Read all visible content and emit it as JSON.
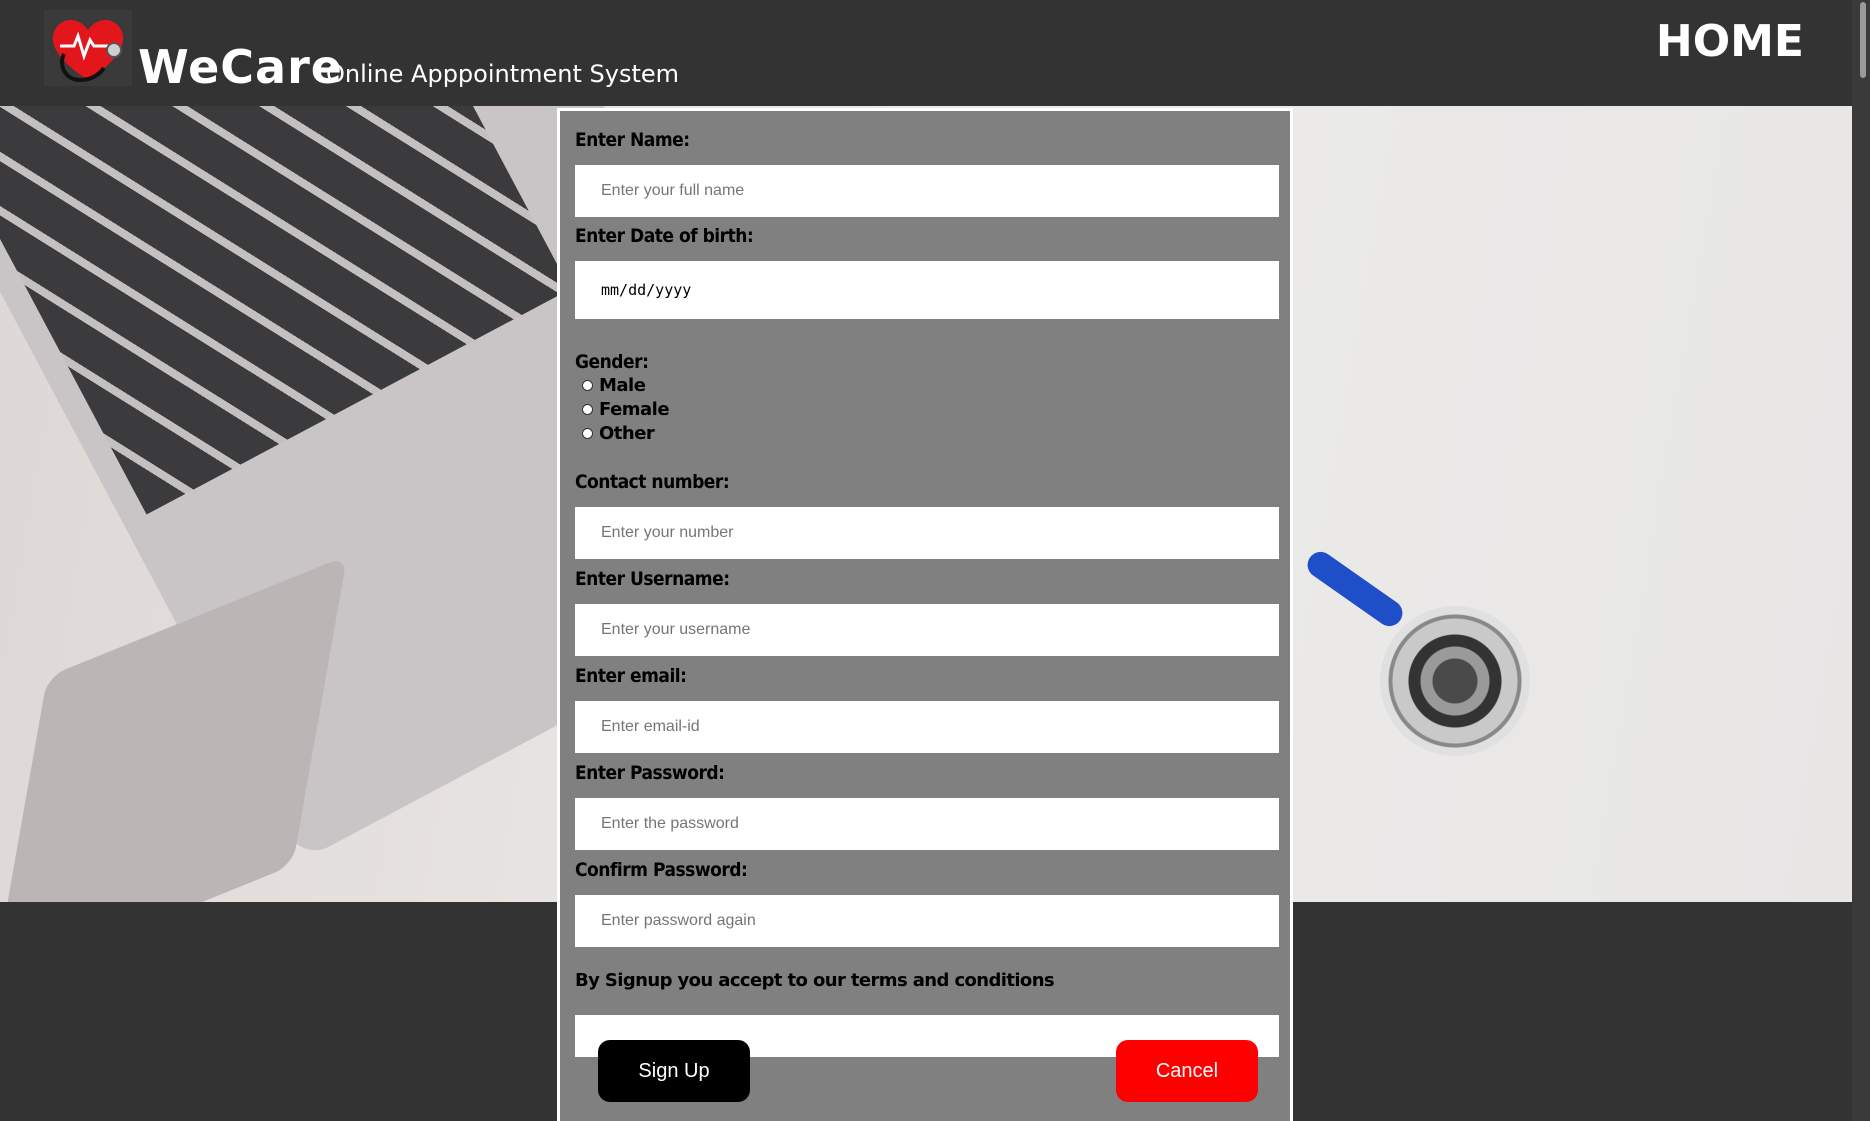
{
  "header": {
    "brand": "WeCare",
    "tagline": "Online Apppointment System",
    "home_label": "HOME"
  },
  "colors": {
    "header_bg": "#333333",
    "form_bg": "#808080",
    "signup_button": "#000000",
    "cancel_button": "#ff0000",
    "logo_heart": "#e3161c"
  },
  "form": {
    "name": {
      "label": "Enter Name:",
      "placeholder": "Enter your full name"
    },
    "dob": {
      "label": "Enter Date of birth:",
      "placeholder": "mm/dd/yyyy"
    },
    "gender": {
      "label": "Gender:",
      "options": [
        "Male",
        "Female",
        "Other"
      ]
    },
    "contact": {
      "label": "Contact number:",
      "placeholder": "Enter your number"
    },
    "username": {
      "label": "Enter Username:",
      "placeholder": "Enter your username"
    },
    "email": {
      "label": "Enter email:",
      "placeholder": "Enter email-id"
    },
    "password": {
      "label": "Enter Password:",
      "placeholder": "Enter the password"
    },
    "confirm_password": {
      "label": "Confirm Password:",
      "placeholder": "Enter password again"
    },
    "terms": "By Signup you accept to our terms and conditions",
    "signup_label": "Sign Up",
    "cancel_label": "Cancel"
  }
}
